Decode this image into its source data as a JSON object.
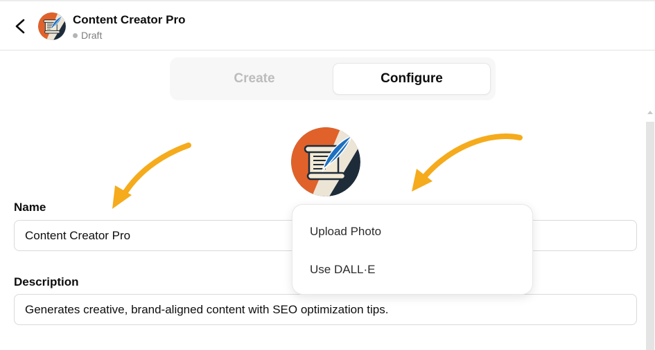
{
  "header": {
    "back_icon": "chevron-left-icon",
    "app_name": "Content Creator Pro",
    "status": "Draft",
    "status_color": "#b4b4b4",
    "avatar_icon": "scroll-quill-icon"
  },
  "tabs": [
    {
      "label": "Create",
      "active": false
    },
    {
      "label": "Configure",
      "active": true
    }
  ],
  "profile_image": {
    "icon": "scroll-quill-icon",
    "colors": {
      "orange": "#e0622a",
      "navy": "#1e2c3a",
      "cream": "#f3ead5",
      "feather_blue": "#1d6fc0"
    }
  },
  "form": {
    "name_label": "Name",
    "name_value": "Content Creator Pro",
    "description_label": "Description",
    "description_value": "Generates creative, brand-aligned content with SEO optimization tips."
  },
  "image_menu": {
    "items": [
      {
        "label": "Upload Photo"
      },
      {
        "label": "Use DALL·E"
      }
    ]
  },
  "annotations": {
    "arrow_color": "#f5ab1c",
    "arrow_icon": "curved-arrow-icon"
  }
}
